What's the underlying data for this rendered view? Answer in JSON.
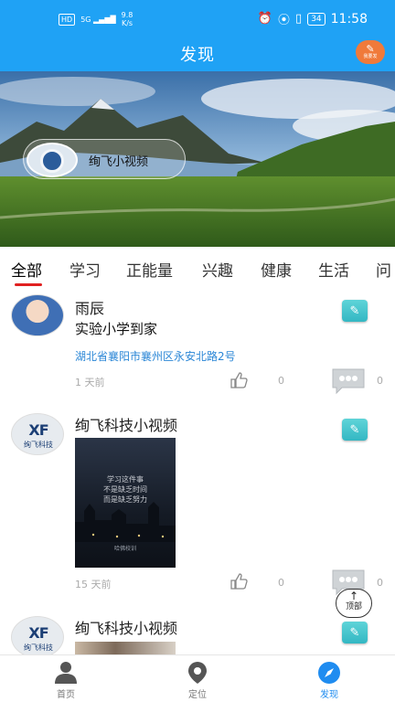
{
  "status_bar": {
    "hd": "HD",
    "signal": "5G",
    "speed_value": "9.8",
    "speed_unit": "K/s",
    "battery": "34",
    "time": "11:58"
  },
  "header": {
    "title": "发现",
    "post_button_label": "我要发"
  },
  "banner": {
    "channel_name": "绚飞小视频"
  },
  "tabs": [
    {
      "label": "全部",
      "active": true
    },
    {
      "label": "学习",
      "active": false
    },
    {
      "label": "正能量",
      "active": false
    },
    {
      "label": "兴趣",
      "active": false
    },
    {
      "label": "健康",
      "active": false
    },
    {
      "label": "生活",
      "active": false
    },
    {
      "label": "问",
      "active": false
    }
  ],
  "posts": [
    {
      "username": "雨辰",
      "content": "实验小学到家",
      "location": "湖北省襄阳市襄州区永安北路2号",
      "time_ago": "1 天前",
      "likes": "0",
      "comments": "0"
    },
    {
      "username": "绚飞科技小视频",
      "video_text_1": "学习这件事",
      "video_text_2": "不是缺乏时间",
      "video_text_3": "而是缺乏努力",
      "video_footer": "哈佛校训",
      "time_ago": "15 天前",
      "likes": "0",
      "comments": "0"
    },
    {
      "username": "绚飞科技小视频"
    }
  ],
  "brand_avatar": {
    "mark": "XF",
    "text": "绚飞科技"
  },
  "back_to_top": {
    "arrow": "↑",
    "label": "顶部"
  },
  "bottom_nav": [
    {
      "label": "首页",
      "icon": "person-icon",
      "active": false
    },
    {
      "label": "定位",
      "icon": "location-pin-icon",
      "active": false
    },
    {
      "label": "发现",
      "icon": "compass-icon",
      "active": true
    }
  ],
  "colors": {
    "header_bg": "#1fa2f5",
    "post_button": "#f07a3a",
    "tab_underline": "#e02020",
    "location_text": "#2a86d6",
    "nav_active": "#1f8cf0",
    "edit_button": "#33b7c3"
  }
}
